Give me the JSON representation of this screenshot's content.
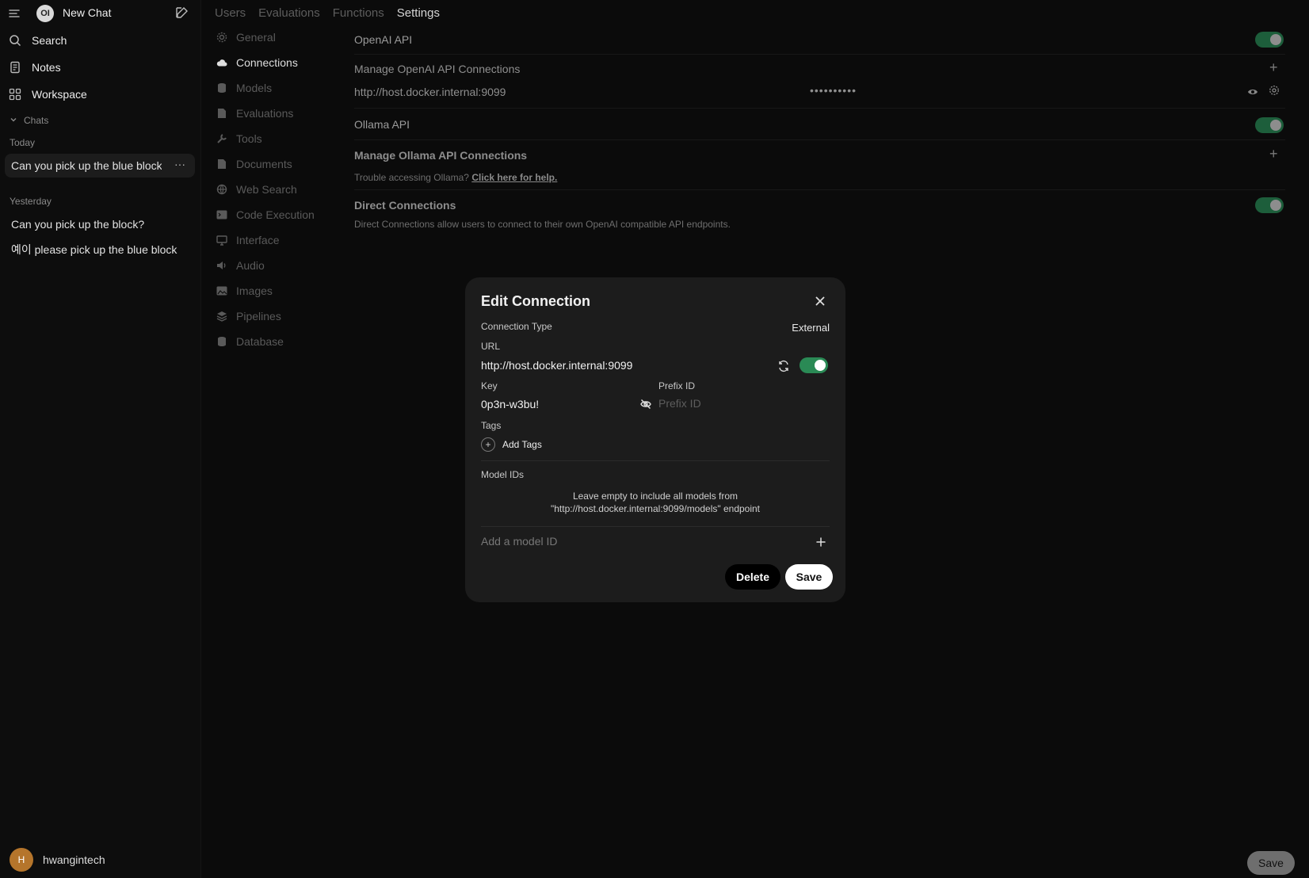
{
  "sidebar": {
    "new_chat_label": "New Chat",
    "logo_text": "OI",
    "nav": [
      {
        "label": "Search",
        "icon": "search-icon"
      },
      {
        "label": "Notes",
        "icon": "notes-icon"
      },
      {
        "label": "Workspace",
        "icon": "workspace-icon"
      }
    ],
    "chats_section": "Chats",
    "today_label": "Today",
    "today_chats": [
      "Can you pick up the blue block"
    ],
    "yesterday_label": "Yesterday",
    "yesterday_chats": [
      "Can you pick up the block?",
      "예이 please pick up the blue block"
    ],
    "user": {
      "initial": "H",
      "name": "hwangintech"
    }
  },
  "topnav": {
    "tabs": [
      "Users",
      "Evaluations",
      "Functions",
      "Settings"
    ],
    "active": "Settings"
  },
  "settings_nav": {
    "items": [
      "General",
      "Connections",
      "Models",
      "Evaluations",
      "Tools",
      "Documents",
      "Web Search",
      "Code Execution",
      "Interface",
      "Audio",
      "Images",
      "Pipelines",
      "Database"
    ],
    "active": "Connections"
  },
  "connections": {
    "openai_api_label": "OpenAI API",
    "openai_enabled": true,
    "manage_openai_label": "Manage OpenAI API Connections",
    "openai_url": "http://host.docker.internal:9099",
    "openai_key_masked": "••••••••••",
    "ollama_api_label": "Ollama API",
    "ollama_enabled": true,
    "manage_ollama_label": "Manage Ollama API Connections",
    "ollama_help_text": "Trouble accessing Ollama?",
    "ollama_help_link": "Click here for help.",
    "direct_label": "Direct Connections",
    "direct_enabled": true,
    "direct_desc": "Direct Connections allow users to connect to their own OpenAI compatible API endpoints."
  },
  "main_save_label": "Save",
  "modal": {
    "title": "Edit Connection",
    "connection_type_label": "Connection Type",
    "connection_type_value": "External",
    "url_label": "URL",
    "url_value": "http://host.docker.internal:9099",
    "url_enabled": true,
    "key_label": "Key",
    "key_value": "0p3n-w3bu!",
    "prefix_label": "Prefix ID",
    "prefix_placeholder": "Prefix ID",
    "tags_label": "Tags",
    "add_tags_label": "Add Tags",
    "model_ids_label": "Model IDs",
    "model_empty_line1": "Leave empty to include all models from",
    "model_empty_line2": "\"http://host.docker.internal:9099/models\" endpoint",
    "add_model_placeholder": "Add a model ID",
    "delete_label": "Delete",
    "save_label": "Save"
  }
}
